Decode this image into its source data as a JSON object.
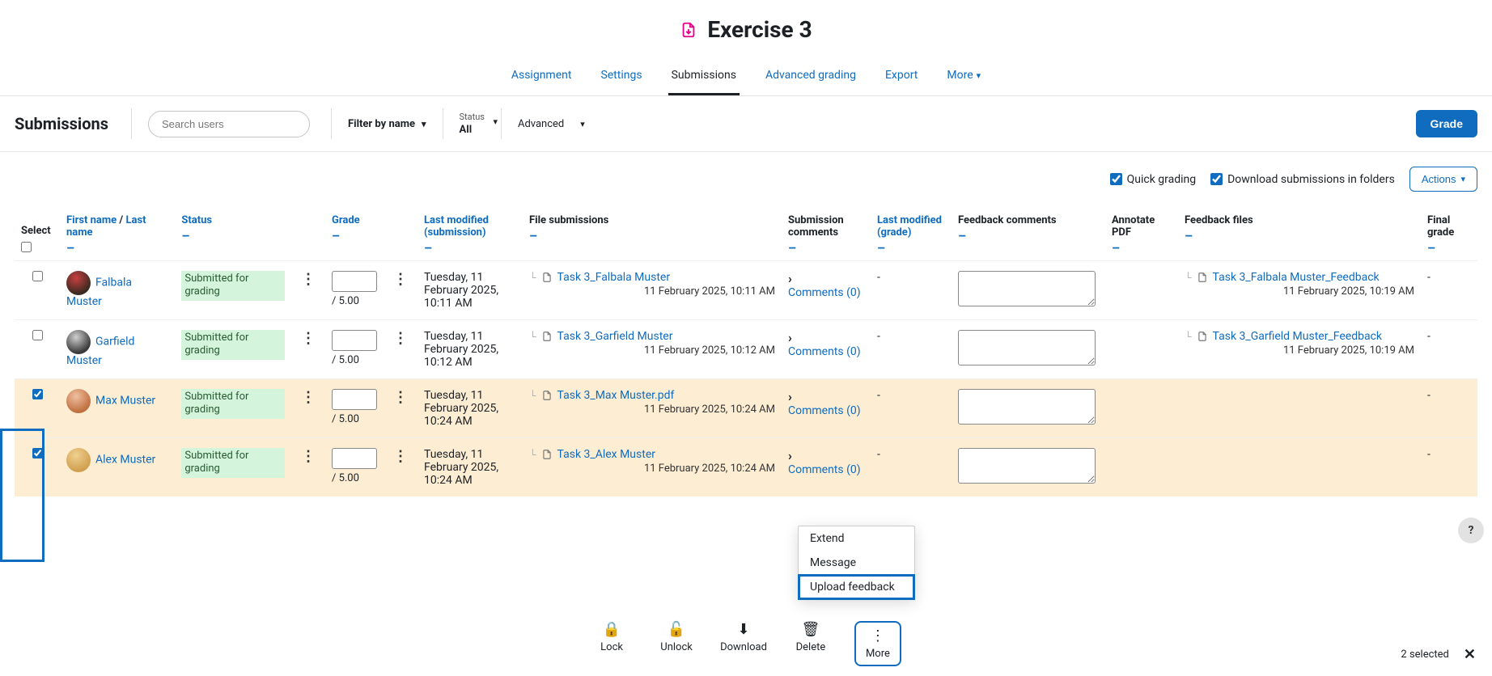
{
  "header": {
    "title": "Exercise 3",
    "tabs": [
      "Assignment",
      "Settings",
      "Submissions",
      "Advanced grading",
      "Export",
      "More"
    ],
    "active_tab": "Submissions"
  },
  "filter_bar": {
    "title": "Submissions",
    "search_placeholder": "Search users",
    "filter_by_name": "Filter by name",
    "status_label": "Status",
    "status_value": "All",
    "advanced": "Advanced",
    "grade_button": "Grade"
  },
  "options": {
    "quick_grading": "Quick grading",
    "download_in_folders": "Download submissions in folders",
    "actions": "Actions"
  },
  "columns": {
    "select": "Select",
    "first_name": "First name",
    "last_name": "Last name",
    "slash": " / ",
    "status": "Status",
    "grade": "Grade",
    "last_mod_submission": "Last modified (submission)",
    "file_submissions": "File submissions",
    "submission_comments": "Submission comments",
    "last_mod_grade": "Last modified (grade)",
    "feedback_comments": "Feedback comments",
    "annotate_pdf": "Annotate PDF",
    "feedback_files": "Feedback files",
    "final_grade": "Final grade"
  },
  "grade_max": "/ 5.00",
  "comments_link": "Comments (0)",
  "rows": [
    {
      "selected": false,
      "avatar": "a1",
      "name": "Falbala Muster",
      "status": "Submitted for grading",
      "submission_date": "Tuesday, 11 February 2025, 10:11 AM",
      "file_name": "Task 3_Falbala Muster",
      "file_date": "11 February 2025, 10:11 AM",
      "last_mod_grade": "-",
      "feedback_file_name": "Task 3_Falbala Muster_Feedback",
      "feedback_file_date": "11 February 2025, 10:19 AM",
      "final_grade": "-"
    },
    {
      "selected": false,
      "avatar": "a2",
      "name": "Garfield Muster",
      "status": "Submitted for grading",
      "submission_date": "Tuesday, 11 February 2025, 10:12 AM",
      "file_name": "Task 3_Garfield Muster",
      "file_date": "11 February 2025, 10:12 AM",
      "last_mod_grade": "-",
      "feedback_file_name": "Task 3_Garfield Muster_Feedback",
      "feedback_file_date": "11 February 2025, 10:19 AM",
      "final_grade": "-"
    },
    {
      "selected": true,
      "avatar": "a3",
      "name": "Max Muster",
      "status": "Submitted for grading",
      "submission_date": "Tuesday, 11 February 2025, 10:24 AM",
      "file_name": "Task 3_Max Muster.pdf",
      "file_date": "11 February 2025, 10:24 AM",
      "last_mod_grade": "-",
      "feedback_file_name": "",
      "feedback_file_date": "",
      "final_grade": "-"
    },
    {
      "selected": true,
      "avatar": "a4",
      "name": "Alex Muster",
      "status": "Submitted for grading",
      "submission_date": "Tuesday, 11 February 2025, 10:24 AM",
      "file_name": "Task 3_Alex Muster",
      "file_date": "11 February 2025, 10:24 AM",
      "last_mod_grade": "-",
      "feedback_file_name": "",
      "feedback_file_date": "",
      "final_grade": "-"
    }
  ],
  "more_menu": [
    "Extend",
    "Message",
    "Upload feedback"
  ],
  "more_menu_highlight": "Upload feedback",
  "bottom_bar": {
    "lock": "Lock",
    "unlock": "Unlock",
    "download": "Download",
    "delete": "Delete",
    "more": "More",
    "selected_count": "2 selected"
  }
}
